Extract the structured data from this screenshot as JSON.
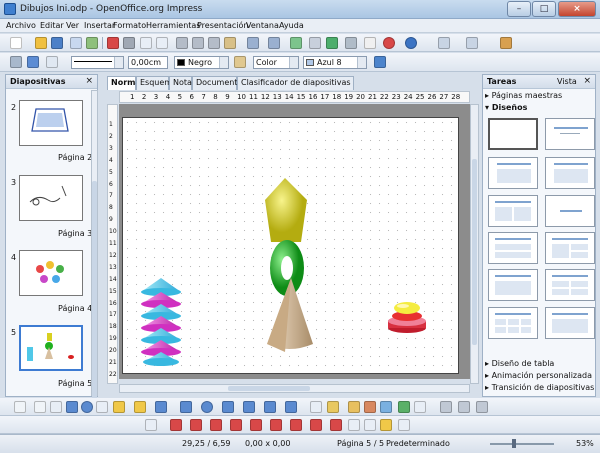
{
  "window": {
    "title": "Dibujos Ini.odp - OpenOffice.org Impress"
  },
  "menu": [
    "Archivo",
    "Editar",
    "Ver",
    "Insertar",
    "Formato",
    "Herramientas",
    "Presentación",
    "Ventana",
    "Ayuda"
  ],
  "line_toolbar": {
    "line_width": "0,00cm",
    "line_color": "Negro",
    "fill_type": "Color",
    "fill_color": "Azul 8"
  },
  "slides_panel": {
    "title": "Diapositivas",
    "slides": [
      {
        "number": "2",
        "label": "Página 2"
      },
      {
        "number": "3",
        "label": "Página 3"
      },
      {
        "number": "4",
        "label": "Página 4"
      },
      {
        "number": "5",
        "label": "Página 5",
        "selected": true
      }
    ]
  },
  "view_tabs": [
    "Normal",
    "Esquema",
    "Notas",
    "Documento",
    "Clasificador de diapositivas"
  ],
  "ruler": {
    "h_ticks": [
      "1",
      "2",
      "3",
      "4",
      "5",
      "6",
      "7",
      "8",
      "9",
      "10",
      "11",
      "12",
      "13",
      "14",
      "15",
      "16",
      "17",
      "18",
      "19",
      "20",
      "21",
      "22",
      "23",
      "24",
      "25",
      "26",
      "27",
      "28"
    ],
    "v_ticks": [
      "1",
      "2",
      "3",
      "4",
      "5",
      "6",
      "7",
      "8",
      "9",
      "10",
      "11",
      "12",
      "13",
      "14",
      "15",
      "16",
      "17",
      "18",
      "19",
      "20",
      "21",
      "22"
    ]
  },
  "tasks_panel": {
    "title": "Tareas",
    "view_label": "Vista",
    "sections": {
      "master": "Páginas maestras",
      "designs": "Diseños",
      "table_design": "Diseño de tabla",
      "custom_animation": "Animación personalizada",
      "transition": "Transición de diapositivas"
    }
  },
  "status": {
    "position": "29,25 / 6,59",
    "size": "0,00 x 0,00",
    "page": "Página 5 / 5",
    "style": "Predeterminado",
    "zoom": "53%"
  },
  "colors": {
    "selection": "#3d7bd2",
    "shape_blue": "#5ad0f0",
    "shape_magenta": "#e040c8",
    "shape_yellow": "#e8e020",
    "shape_green": "#20c020",
    "shape_red": "#d82020",
    "shape_tan": "#e0c8a8"
  }
}
